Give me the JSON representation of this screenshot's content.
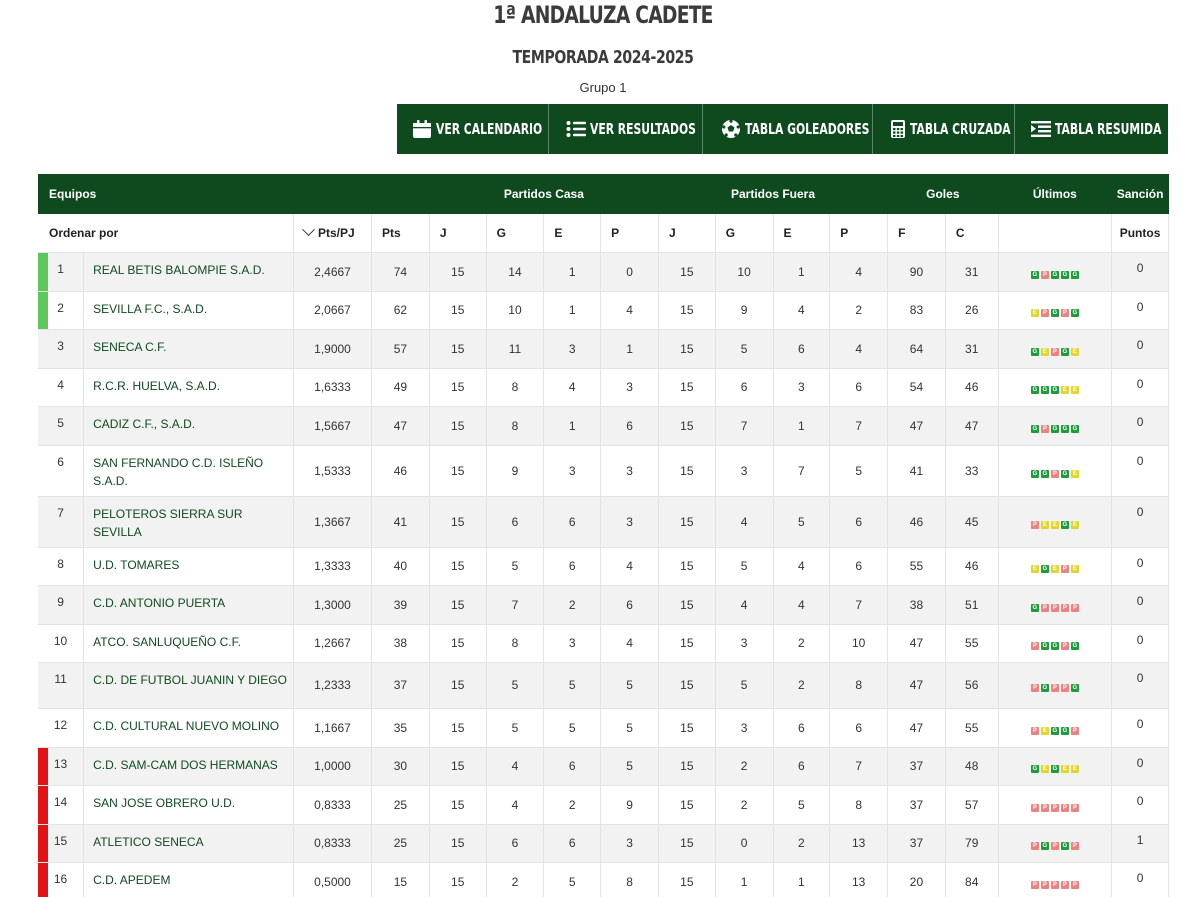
{
  "header": {
    "title": "1ª ANDALUZA CADETE",
    "season": "TEMPORADA 2024-2025",
    "group": "Grupo 1"
  },
  "nav": [
    {
      "label": "VER CALENDARIO",
      "icon": "calendar-icon"
    },
    {
      "label": "VER RESULTADOS",
      "icon": "list-icon"
    },
    {
      "label": "TABLA GOLEADORES",
      "icon": "ball-icon"
    },
    {
      "label": "TABLA CRUZADA",
      "icon": "calculator-icon"
    },
    {
      "label": "TABLA RESUMIDA",
      "icon": "summary-list-icon"
    }
  ],
  "colors": {
    "brand": "#0e4a1d",
    "promotion": "#5cc85c",
    "relegation": "#e01414",
    "win": "#1c9d3a",
    "draw": "#e2d52b",
    "loss": "#ee8080"
  },
  "table": {
    "group_headers": {
      "teams": "Equipos",
      "home": "Partidos Casa",
      "away": "Partidos Fuera",
      "goals": "Goles",
      "last": "Últimos",
      "sanction": "Sanción"
    },
    "sort_label": "Ordenar por",
    "sort_icon": "chevron-down-icon",
    "columns": [
      "Pts/PJ",
      "Pts",
      "J",
      "G",
      "E",
      "P",
      "J",
      "G",
      "E",
      "P",
      "F",
      "C",
      "",
      "Puntos"
    ],
    "rows": [
      {
        "pos": "1",
        "team": "REAL BETIS BALOMPIE S.A.D.",
        "ppg": "2,4667",
        "pts": "74",
        "hj": "15",
        "hg": "14",
        "he": "1",
        "hp": "0",
        "aj": "15",
        "ag": "10",
        "ae": "1",
        "ap": "4",
        "f": "90",
        "c": "31",
        "last": [
          "G",
          "P",
          "G",
          "G",
          "G"
        ],
        "san": "0",
        "zone": "promotion"
      },
      {
        "pos": "2",
        "team": "SEVILLA F.C., S.A.D.",
        "ppg": "2,0667",
        "pts": "62",
        "hj": "15",
        "hg": "10",
        "he": "1",
        "hp": "4",
        "aj": "15",
        "ag": "9",
        "ae": "4",
        "ap": "2",
        "f": "83",
        "c": "26",
        "last": [
          "E",
          "P",
          "G",
          "P",
          "G"
        ],
        "san": "0",
        "zone": "promotion"
      },
      {
        "pos": "3",
        "team": "SENECA C.F.",
        "ppg": "1,9000",
        "pts": "57",
        "hj": "15",
        "hg": "11",
        "he": "3",
        "hp": "1",
        "aj": "15",
        "ag": "5",
        "ae": "6",
        "ap": "4",
        "f": "64",
        "c": "31",
        "last": [
          "G",
          "E",
          "P",
          "G",
          "E"
        ],
        "san": "0",
        "zone": ""
      },
      {
        "pos": "4",
        "team": "R.C.R. HUELVA, S.A.D.",
        "ppg": "1,6333",
        "pts": "49",
        "hj": "15",
        "hg": "8",
        "he": "4",
        "hp": "3",
        "aj": "15",
        "ag": "6",
        "ae": "3",
        "ap": "6",
        "f": "54",
        "c": "46",
        "last": [
          "G",
          "G",
          "G",
          "E",
          "E"
        ],
        "san": "0",
        "zone": ""
      },
      {
        "pos": "5",
        "team": "CADIZ C.F., S.A.D.",
        "ppg": "1,5667",
        "pts": "47",
        "hj": "15",
        "hg": "8",
        "he": "1",
        "hp": "6",
        "aj": "15",
        "ag": "7",
        "ae": "1",
        "ap": "7",
        "f": "47",
        "c": "47",
        "last": [
          "G",
          "P",
          "G",
          "G",
          "G"
        ],
        "san": "0",
        "zone": ""
      },
      {
        "pos": "6",
        "team": "SAN FERNANDO C.D. ISLEÑO S.A.D.",
        "ppg": "1,5333",
        "pts": "46",
        "hj": "15",
        "hg": "9",
        "he": "3",
        "hp": "3",
        "aj": "15",
        "ag": "3",
        "ae": "7",
        "ap": "5",
        "f": "41",
        "c": "33",
        "last": [
          "G",
          "G",
          "P",
          "G",
          "E"
        ],
        "san": "0",
        "zone": ""
      },
      {
        "pos": "7",
        "team": "PELOTEROS SIERRA SUR SEVILLA",
        "ppg": "1,3667",
        "pts": "41",
        "hj": "15",
        "hg": "6",
        "he": "6",
        "hp": "3",
        "aj": "15",
        "ag": "4",
        "ae": "5",
        "ap": "6",
        "f": "46",
        "c": "45",
        "last": [
          "P",
          "E",
          "E",
          "G",
          "E"
        ],
        "san": "0",
        "zone": ""
      },
      {
        "pos": "8",
        "team": "U.D. TOMARES",
        "ppg": "1,3333",
        "pts": "40",
        "hj": "15",
        "hg": "5",
        "he": "6",
        "hp": "4",
        "aj": "15",
        "ag": "5",
        "ae": "4",
        "ap": "6",
        "f": "55",
        "c": "46",
        "last": [
          "E",
          "G",
          "E",
          "P",
          "E"
        ],
        "san": "0",
        "zone": ""
      },
      {
        "pos": "9",
        "team": "C.D. ANTONIO PUERTA",
        "ppg": "1,3000",
        "pts": "39",
        "hj": "15",
        "hg": "7",
        "he": "2",
        "hp": "6",
        "aj": "15",
        "ag": "4",
        "ae": "4",
        "ap": "7",
        "f": "38",
        "c": "51",
        "last": [
          "G",
          "P",
          "P",
          "P",
          "P"
        ],
        "san": "0",
        "zone": ""
      },
      {
        "pos": "10",
        "team": "ATCO. SANLUQUEÑO C.F.",
        "ppg": "1,2667",
        "pts": "38",
        "hj": "15",
        "hg": "8",
        "he": "3",
        "hp": "4",
        "aj": "15",
        "ag": "3",
        "ae": "2",
        "ap": "10",
        "f": "47",
        "c": "55",
        "last": [
          "P",
          "G",
          "G",
          "P",
          "G"
        ],
        "san": "0",
        "zone": ""
      },
      {
        "pos": "11",
        "team": "C.D. DE FUTBOL JUANIN Y DIEGO",
        "ppg": "1,2333",
        "pts": "37",
        "hj": "15",
        "hg": "5",
        "he": "5",
        "hp": "5",
        "aj": "15",
        "ag": "5",
        "ae": "2",
        "ap": "8",
        "f": "47",
        "c": "56",
        "last": [
          "P",
          "G",
          "P",
          "P",
          "G"
        ],
        "san": "0",
        "zone": ""
      },
      {
        "pos": "12",
        "team": "C.D. CULTURAL NUEVO MOLINO",
        "ppg": "1,1667",
        "pts": "35",
        "hj": "15",
        "hg": "5",
        "he": "5",
        "hp": "5",
        "aj": "15",
        "ag": "3",
        "ae": "6",
        "ap": "6",
        "f": "47",
        "c": "55",
        "last": [
          "P",
          "E",
          "G",
          "G",
          "P"
        ],
        "san": "0",
        "zone": ""
      },
      {
        "pos": "13",
        "team": "C.D. SAM-CAM DOS HERMANAS",
        "ppg": "1,0000",
        "pts": "30",
        "hj": "15",
        "hg": "4",
        "he": "6",
        "hp": "5",
        "aj": "15",
        "ag": "2",
        "ae": "6",
        "ap": "7",
        "f": "37",
        "c": "48",
        "last": [
          "G",
          "E",
          "G",
          "E",
          "E"
        ],
        "san": "0",
        "zone": "relegation"
      },
      {
        "pos": "14",
        "team": "SAN JOSE OBRERO U.D.",
        "ppg": "0,8333",
        "pts": "25",
        "hj": "15",
        "hg": "4",
        "he": "2",
        "hp": "9",
        "aj": "15",
        "ag": "2",
        "ae": "5",
        "ap": "8",
        "f": "37",
        "c": "57",
        "last": [
          "P",
          "P",
          "P",
          "P",
          "P"
        ],
        "san": "0",
        "zone": "relegation"
      },
      {
        "pos": "15",
        "team": "ATLETICO SENECA",
        "ppg": "0,8333",
        "pts": "25",
        "hj": "15",
        "hg": "6",
        "he": "6",
        "hp": "3",
        "aj": "15",
        "ag": "0",
        "ae": "2",
        "ap": "13",
        "f": "37",
        "c": "79",
        "last": [
          "P",
          "G",
          "P",
          "G",
          "P"
        ],
        "san": "1",
        "zone": "relegation"
      },
      {
        "pos": "16",
        "team": "C.D. APEDEM",
        "ppg": "0,5000",
        "pts": "15",
        "hj": "15",
        "hg": "2",
        "he": "5",
        "hp": "8",
        "aj": "15",
        "ag": "1",
        "ae": "1",
        "ap": "13",
        "f": "20",
        "c": "84",
        "last": [
          "P",
          "P",
          "P",
          "P",
          "P"
        ],
        "san": "0",
        "zone": "relegation"
      }
    ]
  }
}
